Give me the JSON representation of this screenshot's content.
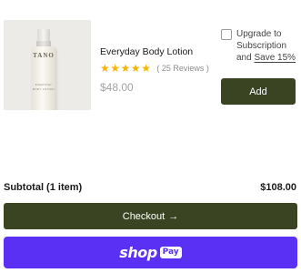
{
  "product": {
    "image_brand": "TANO",
    "image_line1": "EVERYDAY",
    "image_line2": "BODY LOTION",
    "title": "Everyday Body Lotion",
    "rating": 5,
    "reviews_text": "( 25 Reviews )",
    "price": "$48.00",
    "star_color": "#f2b705"
  },
  "subscription": {
    "checked": false,
    "label_line1": "Upgrade to",
    "label_line2": "Subscription",
    "label_and": "and",
    "save_link": "Save 15%"
  },
  "add_button_label": "Add",
  "summary": {
    "subtotal_label": "Subtotal (1 item)",
    "subtotal_value": "$108.00"
  },
  "checkout": {
    "label": "Checkout",
    "arrow": "→"
  },
  "shop_pay": {
    "shop": "shop",
    "pay": "Pay",
    "color": "#5a31f4"
  },
  "colors": {
    "accent_button": "#3a4423",
    "price_gray": "#a3a3a3"
  }
}
